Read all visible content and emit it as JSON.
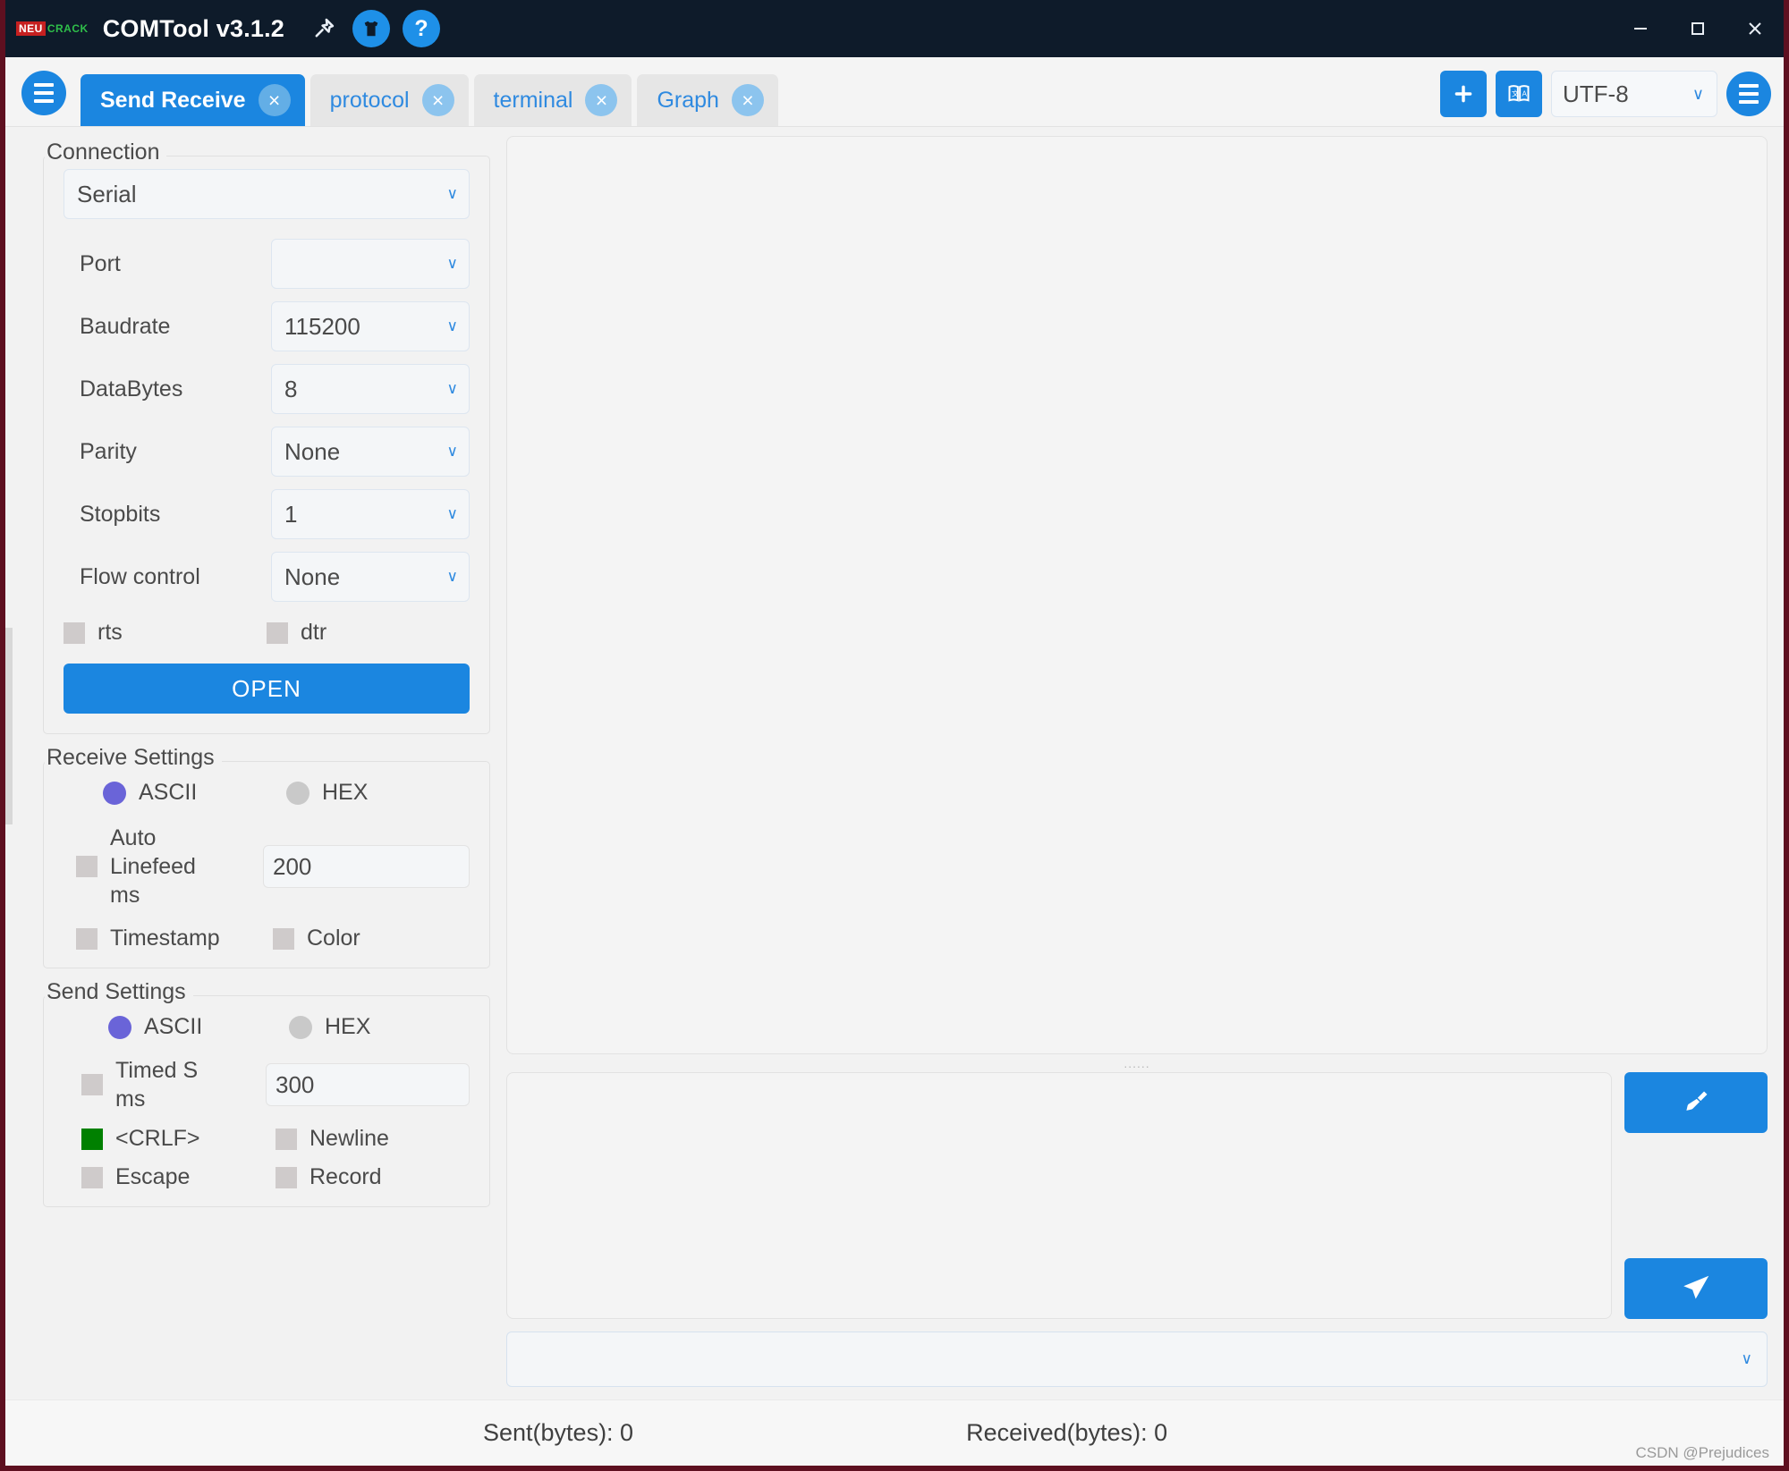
{
  "window": {
    "brand_left": "NEU",
    "brand_right": "CRACK",
    "title": "COMTool v3.1.2",
    "pin_icon": "pin-icon",
    "shirt_icon": "skin-icon",
    "help_icon": "help-icon",
    "minimize": "minimize-icon",
    "maximize": "maximize-icon",
    "close": "close-icon"
  },
  "tabbar": {
    "menu_icon": "hamburger-icon",
    "tabs": [
      {
        "label": "Send Receive",
        "active": true,
        "close": "×"
      },
      {
        "label": "protocol",
        "active": false,
        "close": "×"
      },
      {
        "label": "terminal",
        "active": false,
        "close": "×"
      },
      {
        "label": "Graph",
        "active": false,
        "close": "×"
      }
    ],
    "add_label": "+",
    "translate_icon": "translate-icon",
    "encoding": "UTF-8",
    "encoding_chev": "∨",
    "right_menu_icon": "hamburger-icon"
  },
  "connection": {
    "title": "Connection",
    "type": "Serial",
    "fields": [
      {
        "label": "Port",
        "value": ""
      },
      {
        "label": "Baudrate",
        "value": "115200"
      },
      {
        "label": "DataBytes",
        "value": "8"
      },
      {
        "label": "Parity",
        "value": "None"
      },
      {
        "label": "Stopbits",
        "value": "1"
      },
      {
        "label": "Flow control",
        "value": "None"
      }
    ],
    "rts_label": "rts",
    "rts_checked": false,
    "dtr_label": "dtr",
    "dtr_checked": false,
    "open_label": "OPEN"
  },
  "receive_settings": {
    "title": "Receive Settings",
    "ascii_label": "ASCII",
    "ascii_selected": true,
    "hex_label": "HEX",
    "hex_selected": false,
    "auto_linefeed_line1": "Auto",
    "auto_linefeed_line2": "Linefeed",
    "auto_linefeed_line3": "ms",
    "auto_linefeed_checked": false,
    "auto_linefeed_value": "200",
    "timestamp_label": "Timestamp",
    "timestamp_checked": false,
    "color_label": "Color",
    "color_checked": false
  },
  "send_settings": {
    "title": "Send Settings",
    "ascii_label": "ASCII",
    "ascii_selected": true,
    "hex_label": "HEX",
    "hex_selected": false,
    "timed_send_line1": "Timed S",
    "timed_send_line2": "ms",
    "timed_send_checked": false,
    "timed_send_value": "300",
    "crlf_label": "<CRLF>",
    "crlf_checked": true,
    "newline_label": "Newline",
    "newline_checked": false,
    "escape_label": "Escape",
    "escape_checked": false,
    "record_label": "Record",
    "record_checked": false
  },
  "main": {
    "receive_text": "",
    "send_text": "",
    "splitter_dots": "......",
    "clear_icon": "broom-icon",
    "send_icon": "send-icon",
    "history_value": "",
    "history_chev": "∨"
  },
  "status": {
    "sent": "Sent(bytes): 0",
    "received": "Received(bytes): 0",
    "watermark": "CSDN @Prejudices"
  },
  "colors": {
    "accent": "#1b86e0",
    "titlebar": "#0e1b2a",
    "radio_selected": "#6a64d8",
    "checkbox_checked": "#008000",
    "tab_inactive": "#e6e6e6",
    "desktop": "#5e1020"
  }
}
